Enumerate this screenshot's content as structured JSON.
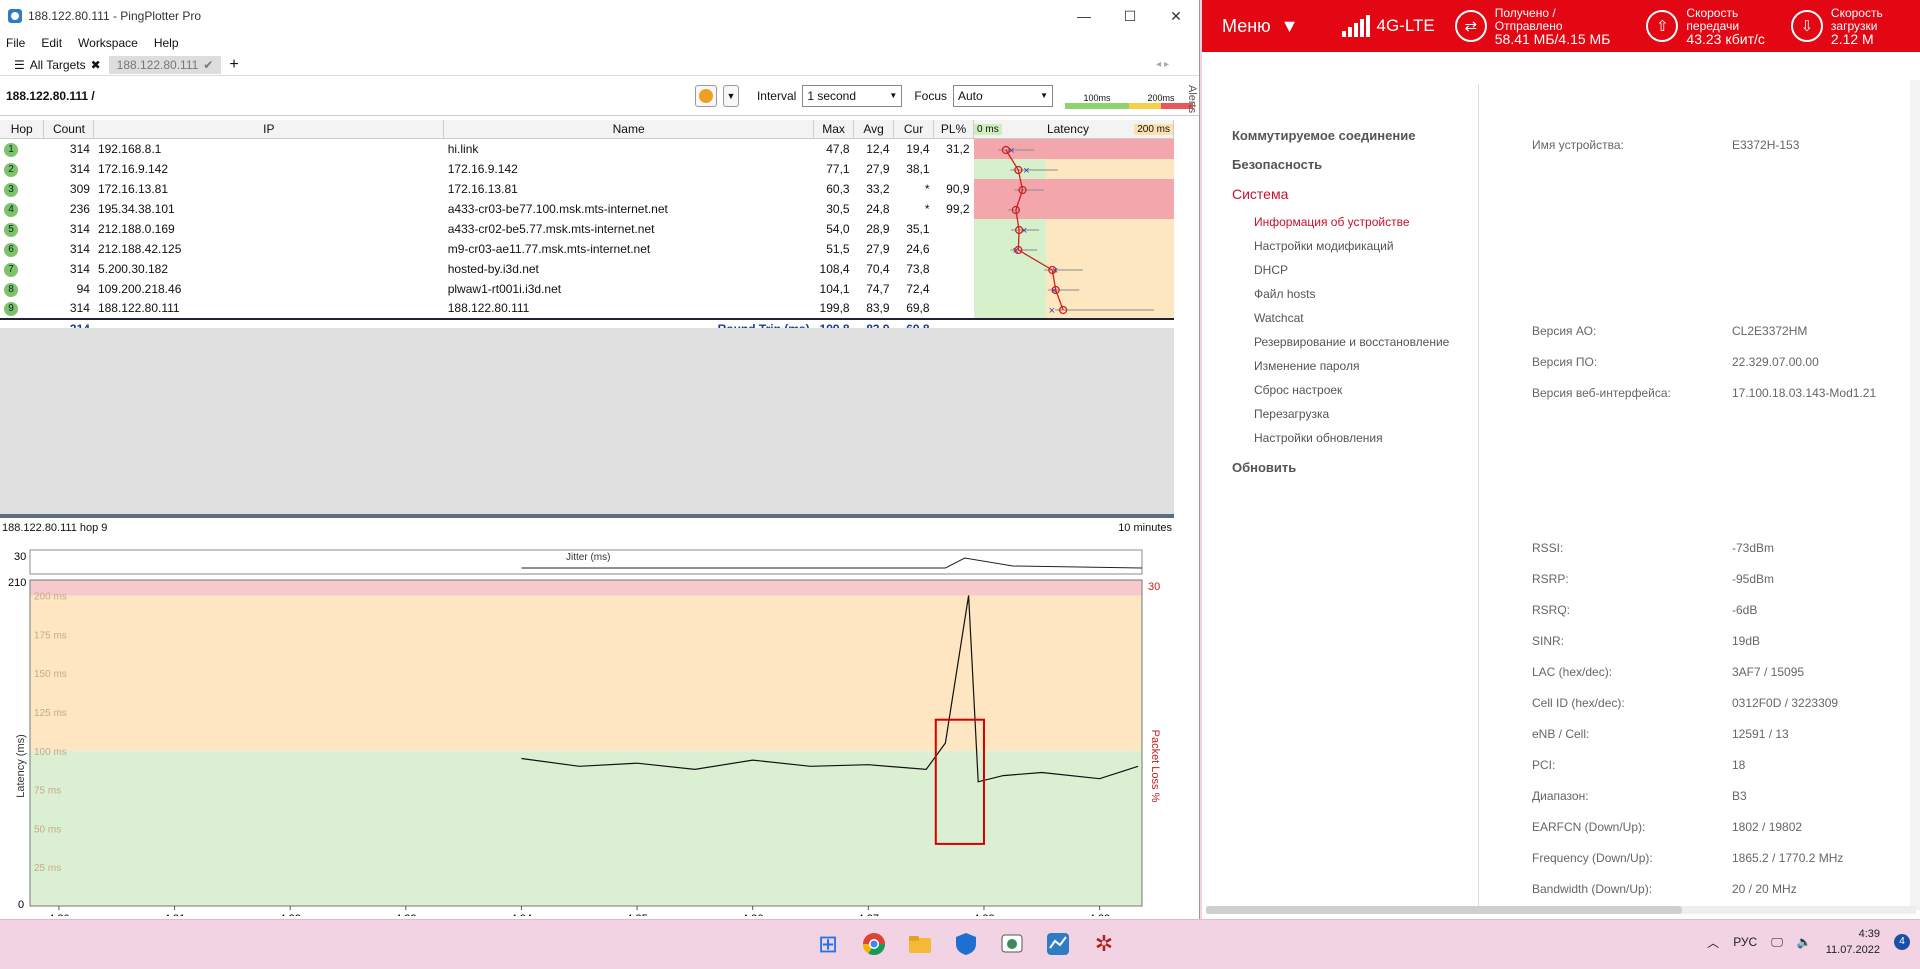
{
  "pingplotter": {
    "title": "188.122.80.111 - PingPlotter Pro",
    "menu": [
      "File",
      "Edit",
      "Workspace",
      "Help"
    ],
    "tabs": {
      "all_targets": "All Targets",
      "active": "188.122.80.111"
    },
    "target_label": "188.122.80.111 /",
    "interval_label": "Interval",
    "interval_value": "1 second",
    "focus_label": "Focus",
    "focus_value": "Auto",
    "scale_labels": [
      "100ms",
      "200ms"
    ],
    "alerts": "Alerts",
    "columns": {
      "hop": "Hop",
      "count": "Count",
      "ip": "IP",
      "name": "Name",
      "max": "Max",
      "avg": "Avg",
      "cur": "Cur",
      "pl": "PL%",
      "lat_min": "0 ms",
      "latency": "Latency",
      "lat_max": "200 ms"
    },
    "hops": [
      {
        "hop": "1",
        "count": "314",
        "ip": "192.168.8.1",
        "name": "hi.link",
        "max": "47,8",
        "avg": "12,4",
        "cur": "19,4",
        "pl": "31,2",
        "avg_ms": 12.4,
        "cur_ms": 19.4,
        "max_ms": 47.8,
        "loss": true
      },
      {
        "hop": "2",
        "count": "314",
        "ip": "172.16.9.142",
        "name": "172.16.9.142",
        "max": "77,1",
        "avg": "27,9",
        "cur": "38,1",
        "pl": "",
        "avg_ms": 27.9,
        "cur_ms": 38.1,
        "max_ms": 77.1,
        "loss": false
      },
      {
        "hop": "3",
        "count": "309",
        "ip": "172.16.13.81",
        "name": "172.16.13.81",
        "max": "60,3",
        "avg": "33,2",
        "cur": "*",
        "pl": "90,9",
        "avg_ms": 33.2,
        "cur_ms": null,
        "max_ms": 60.3,
        "loss": true
      },
      {
        "hop": "4",
        "count": "236",
        "ip": "195.34.38.101",
        "name": "a433-cr03-be77.100.msk.mts-internet.net",
        "max": "30,5",
        "avg": "24,8",
        "cur": "*",
        "pl": "99,2",
        "avg_ms": 24.8,
        "cur_ms": null,
        "max_ms": 30.5,
        "loss": true
      },
      {
        "hop": "5",
        "count": "314",
        "ip": "212.188.0.169",
        "name": "a433-cr02-be5.77.msk.mts-internet.net",
        "max": "54,0",
        "avg": "28,9",
        "cur": "35,1",
        "pl": "",
        "avg_ms": 28.9,
        "cur_ms": 35.1,
        "max_ms": 54.0,
        "loss": false
      },
      {
        "hop": "6",
        "count": "314",
        "ip": "212.188.42.125",
        "name": "m9-cr03-ae11.77.msk.mts-internet.net",
        "max": "51,5",
        "avg": "27,9",
        "cur": "24,6",
        "pl": "",
        "avg_ms": 27.9,
        "cur_ms": 24.6,
        "max_ms": 51.5,
        "loss": false
      },
      {
        "hop": "7",
        "count": "314",
        "ip": "5.200.30.182",
        "name": "hosted-by.i3d.net",
        "max": "108,4",
        "avg": "70,4",
        "cur": "73,8",
        "pl": "",
        "avg_ms": 70.4,
        "cur_ms": 73.8,
        "max_ms": 108.4,
        "loss": false
      },
      {
        "hop": "8",
        "count": "94",
        "ip": "109.200.218.46",
        "name": "plwaw1-rt001i.i3d.net",
        "max": "104,1",
        "avg": "74,7",
        "cur": "72,4",
        "pl": "",
        "avg_ms": 74.7,
        "cur_ms": 72.4,
        "max_ms": 104.1,
        "loss": false
      },
      {
        "hop": "9",
        "count": "314",
        "ip": "188.122.80.111",
        "name": "188.122.80.111",
        "max": "199,8",
        "avg": "83,9",
        "cur": "69,8",
        "pl": "",
        "avg_ms": 83.9,
        "cur_ms": 69.8,
        "max_ms": 199.8,
        "loss": false
      }
    ],
    "round_trip": {
      "count": "314",
      "label": "Round Trip (ms)",
      "max": "199,8",
      "avg": "83,9",
      "cur": "69,8"
    },
    "graph": {
      "header_left": "188.122.80.111 hop 9",
      "header_right": "10 minutes",
      "jitter_label": "Jitter (ms)",
      "jitter_max": "30",
      "y_top": "210",
      "y_zero": "0",
      "pl_max": "30",
      "y_axis_label": "Latency (ms)",
      "pl_axis_label": "Packet Loss %",
      "y_ticks": [
        "200 ms",
        "175 ms",
        "150 ms",
        "125 ms",
        "100 ms",
        "75 ms",
        "50 ms",
        "25 ms"
      ],
      "x_ticks": [
        "4:30",
        "4:31",
        "4:32",
        "4:33",
        "4:34",
        "4:35",
        "4:36",
        "4:37",
        "4:38",
        "4:39"
      ]
    }
  },
  "chart_data": {
    "type": "line",
    "title": "",
    "xlabel": "",
    "ylabel": "Latency (ms)",
    "ylim": [
      0,
      210
    ],
    "x_range": [
      "4:29:45",
      "4:39:22"
    ],
    "series": [
      {
        "name": "",
        "x": [
          "4:34:00",
          "4:34:30",
          "4:35:00",
          "4:35:30",
          "4:36:00",
          "4:36:30",
          "4:37:00",
          "4:37:30",
          "4:37:40",
          "4:37:52",
          "4:37:57",
          "4:38:10",
          "4:38:30",
          "4:39:00",
          "4:39:20"
        ],
        "values": [
          95,
          90,
          92,
          88,
          94,
          90,
          91,
          88,
          105,
          200,
          80,
          84,
          86,
          82,
          90
        ]
      }
    ],
    "highlight": {
      "x": [
        "4:37:35",
        "4:38:00"
      ],
      "y": [
        40,
        120
      ],
      "color": "#d40000"
    }
  },
  "router": {
    "menu": "Меню",
    "network": "4G-LTE",
    "traffic_label": "Получено / Отправлено",
    "traffic_value": "58.41 МБ/4.15 МБ",
    "up_label": "Скорость передачи",
    "up_value": "43.23 кбит/с",
    "down_label": "Скорость загрузки",
    "down_value": "2.12 М",
    "nav": {
      "dialup": "Коммутируемое соединение",
      "security": "Безопасность",
      "system": "Система",
      "sub": [
        "Информация об устройстве",
        "Настройки модификаций",
        "DHCP",
        "Файл hosts",
        "Watchcat",
        "Резервирование и восстановление",
        "Изменение пароля",
        "Сброс настроек",
        "Перезагрузка",
        "Настройки обновления"
      ],
      "update": "Обновить"
    },
    "info": [
      {
        "k": "Имя устройства:",
        "v": "E3372H-153"
      },
      {
        "k": "Версия АО:",
        "v": "CL2E3372HM"
      },
      {
        "k": "Версия ПО:",
        "v": "22.329.07.00.00"
      },
      {
        "k": "Версия веб-интерфейса:",
        "v": "17.100.18.03.143-Mod1.21"
      },
      {
        "k": "RSSI:",
        "v": "-73dBm"
      },
      {
        "k": "RSRP:",
        "v": "-95dBm"
      },
      {
        "k": "RSRQ:",
        "v": "-6dB"
      },
      {
        "k": "SINR:",
        "v": "19dB"
      },
      {
        "k": "LAC (hex/dec):",
        "v": "3AF7 / 15095"
      },
      {
        "k": "Cell ID (hex/dec):",
        "v": "0312F0D / 3223309"
      },
      {
        "k": "eNB / Cell:",
        "v": "12591 / 13"
      },
      {
        "k": "PCI:",
        "v": "18"
      },
      {
        "k": "Диапазон:",
        "v": "B3"
      },
      {
        "k": "EARFCN (Down/Up):",
        "v": "1802 / 19802"
      },
      {
        "k": "Frequency (Down/Up):",
        "v": "1865.2 / 1770.2 MHz"
      },
      {
        "k": "Bandwidth (Down/Up):",
        "v": "20 / 20 MHz"
      }
    ]
  },
  "taskbar": {
    "lang": "РУС",
    "time": "4:39",
    "date": "11.07.2022",
    "notifications": "4"
  }
}
